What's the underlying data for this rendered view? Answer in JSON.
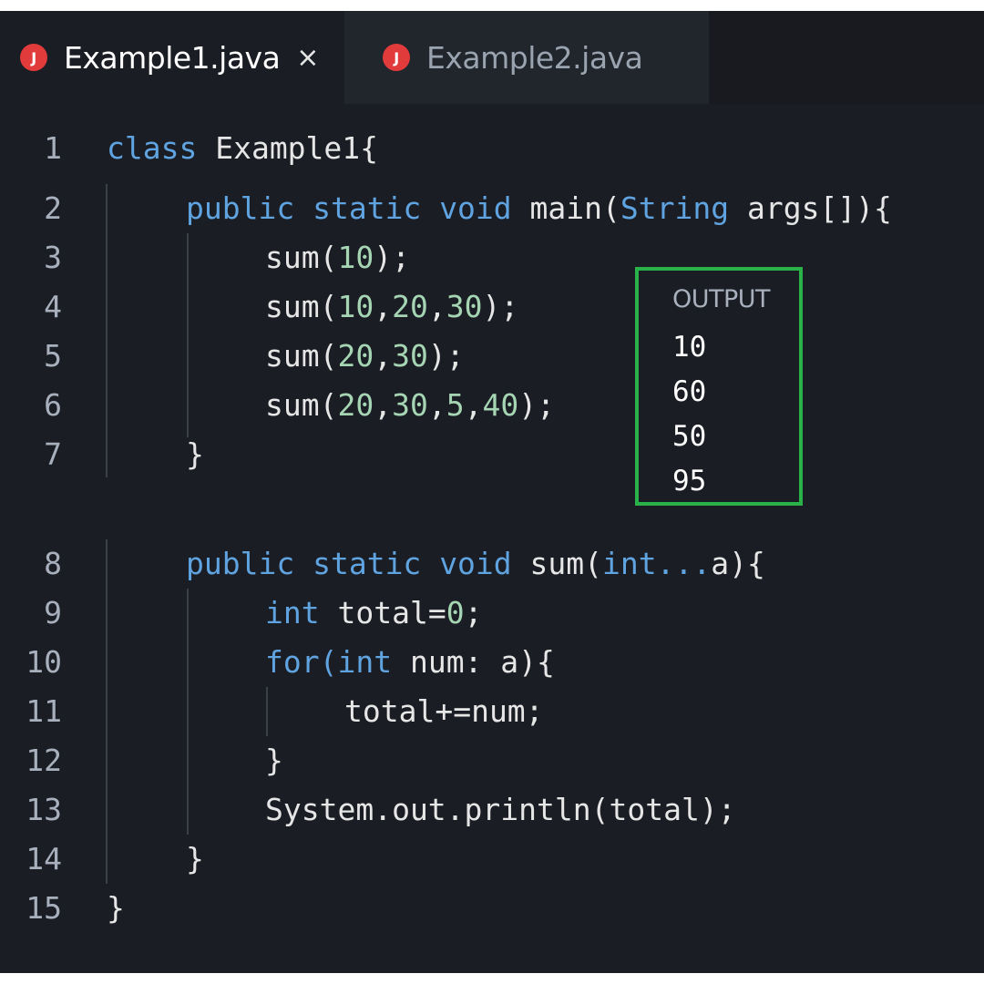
{
  "tabs": [
    {
      "label": "Example1.java",
      "icon_letter": "J",
      "close_glyph": "×"
    },
    {
      "label": "Example2.java",
      "icon_letter": "J"
    }
  ],
  "gutter": [
    "1",
    "2",
    "3",
    "4",
    "5",
    "6",
    "7",
    "8",
    "9",
    "10",
    "11",
    "12",
    "13",
    "14",
    "15"
  ],
  "code": {
    "l1": {
      "kw": "class",
      "text": " Example1{"
    },
    "l2": {
      "kw1": "public",
      "kw2": "static",
      "kw3": "void",
      "text1": " main(",
      "kw4": "String",
      "text2": " args[]){"
    },
    "l3": {
      "t1": "sum(",
      "n1": "10",
      "t2": ");"
    },
    "l4": {
      "t1": "sum(",
      "n1": "10",
      "c1": ",",
      "n2": "20",
      "c2": ",",
      "n3": "30",
      "t2": ");"
    },
    "l5": {
      "t1": "sum(",
      "n1": "20",
      "c1": ",",
      "n2": "30",
      "t2": ");"
    },
    "l6": {
      "t1": "sum(",
      "n1": "20",
      "c1": ",",
      "n2": "30",
      "c2": ",",
      "n3": "5",
      "c3": ",",
      "n4": "40",
      "t2": ");"
    },
    "l7": {
      "text": "}"
    },
    "l8": {
      "kw1": "public",
      "kw2": "static",
      "kw3": "void",
      "text1": " sum(",
      "kw4": "int...",
      "text2": "a){"
    },
    "l9": {
      "kw": "int",
      "text": " total=",
      "n1": "0",
      "t2": ";"
    },
    "l10": {
      "kw1": "for",
      "t1": "(",
      "kw2": "int",
      "text": " num: a){"
    },
    "l11": {
      "text": "total+=num;"
    },
    "l12": {
      "text": "}"
    },
    "l13": {
      "text": "System.out.println(total);"
    },
    "l14": {
      "text": "}"
    },
    "l15": {
      "text": "}"
    }
  },
  "output": {
    "title": "OUTPUT",
    "values": [
      "10",
      "60",
      "50",
      "95"
    ]
  },
  "colors": {
    "keyword": "#5fa3e0",
    "number": "#a6d5b4",
    "output_border": "#2ab24a",
    "file_icon": "#e23b3b"
  }
}
